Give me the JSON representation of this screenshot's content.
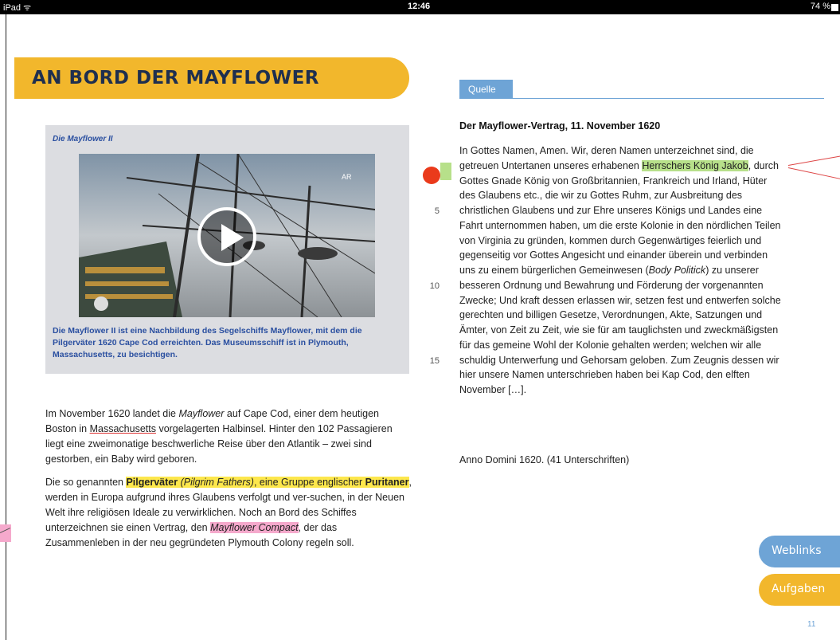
{
  "status_bar": {
    "device": "iPad ᯤ",
    "time": "12:46",
    "battery": "74 %"
  },
  "chapter_title": "AN BORD DER MAYFLOWER",
  "image_box": {
    "caption_title": "Die Mayflower II",
    "caption_text": "Die Mayflower II ist eine Nachbildung des Segelschiffs Mayflower, mit dem die Pilgerväter 1620 Cape Cod erreichten. Das Museumsschiff ist in Plymouth, Massachusetts, zu besichtigen.",
    "photo_watermark": "AR"
  },
  "body_left": {
    "p1_a": "Im November 1620 landet die ",
    "p1_ship": "Mayflower",
    "p1_b": " auf Cape Cod, einer dem heutigen Boston in ",
    "p1_state": "Massachusetts",
    "p1_c": " vorgelagerten Halbinsel. Hinter den 102 Passagieren liegt eine zweimonatige beschwerliche Reise über den Atlantik – zwei sind gestorben, ein Baby wird geboren.",
    "p2_a": "Die so genannten ",
    "p2_term": "Pilgerväter",
    "p2_en": " (Pilgrim Fathers)",
    "p2_b": ", eine Gruppe englischer ",
    "p2_term2": "Puritaner",
    "p2_c": ", werden in Europa aufgrund ihres Glaubens verfolgt und ver-suchen, in der Neuen Welt ihre religiösen Ideale zu verwirklichen. Noch an Bord des Schiffes unterzeichnen sie einen Vertrag, den ",
    "p2_compact": "Mayflower Compact",
    "p2_d": ", der das Zusammenleben in der neu gegründeten Plymouth Colony regeln soll."
  },
  "source": {
    "tab_label": "Quelle",
    "title": "Der Mayflower-Vertrag, 11. November 1620",
    "lines": [
      "In Gottes Namen, Amen. Wir, deren Namen unterzeichnet sind, die",
      "getreuen Untertanen unseres erhabenen ",
      "Gottes Gnade König von Großbritannien, Frankreich und Irland, Hüter",
      "des Glaubens etc., die wir zu Gottes Ruhm, zur Ausbreitung des",
      "christlichen Glaubens und zur Ehre unseres Königs und Landes eine",
      "Fahrt unternommen haben, um die erste Kolonie in den nördlichen Teilen",
      "von Virginia zu gründen, kommen durch Gegenwärtiges feierlich und",
      "gegenseitig vor Gottes Angesicht und einander überein und verbinden",
      "uns zu einem bürgerlichen Gemeinwesen (",
      "besseren Ordnung und Bewahrung und Förderung der vorgenannten",
      "Zwecke; Und kraft dessen erlassen wir, setzen fest und entwerfen solche",
      "gerechten und billigen Gesetze, Verordnungen, Akte, Satzungen und",
      "Ämter, von Zeit zu Zeit, wie sie für am tauglichsten und zweckmäßigsten",
      "für das gemeine Wohl der Kolonie gehalten werden; welchen wir alle",
      "schuldig Unterwerfung und Gehorsam geloben. Zum Zeugnis dessen wir",
      "hier unsere Namen unterschrieben haben bei Kap Cod, den elften",
      "November […]."
    ],
    "highlight": "Herrschers König Jakob",
    "line2_tail": ", durch",
    "body_politick": "Body Politick",
    "line9_tail": ") zu unserer",
    "line_numbers": [
      "5",
      "10",
      "15"
    ],
    "signature": "Anno Domini 1620. (41 Unterschriften)"
  },
  "buttons": {
    "weblinks": "Weblinks",
    "aufgaben": "Aufgaben"
  },
  "page_number": "11",
  "colors": {
    "title_yellow": "#f2b72c",
    "accent_blue": "#6ea4d6",
    "caption_blue": "#2a4fa0",
    "highlight_yellow": "#fde74c",
    "highlight_pink": "#f5a9cc",
    "highlight_green": "#b7e08a",
    "marker_red": "#ea3a1b"
  }
}
